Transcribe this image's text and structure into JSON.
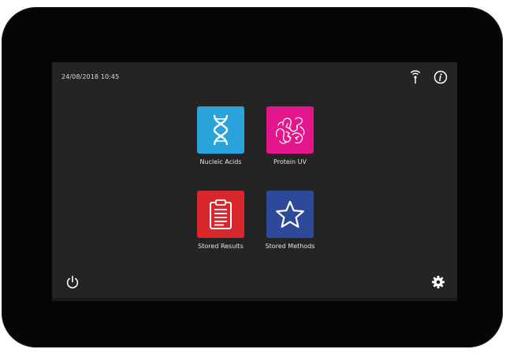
{
  "status_bar": {
    "datetime": "24/08/2018  10:45",
    "icons": [
      "wireless-icon",
      "info-icon"
    ]
  },
  "tiles": [
    {
      "label": "Nucleic Acids",
      "icon": "dna-icon",
      "color": "#2aa3da"
    },
    {
      "label": "Protein UV",
      "icon": "protein-icon",
      "color": "#e3168c"
    },
    {
      "label": "Stored Results",
      "icon": "clipboard-icon",
      "color": "#d7262c"
    },
    {
      "label": "Stored Methods",
      "icon": "star-icon",
      "color": "#2d4a9a"
    }
  ],
  "footer": {
    "left_icon": "power-icon",
    "right_icon": "gear-icon"
  },
  "colors": {
    "screen_background": "#242424",
    "bezel": "#050505",
    "text": "#e4e4e4"
  }
}
